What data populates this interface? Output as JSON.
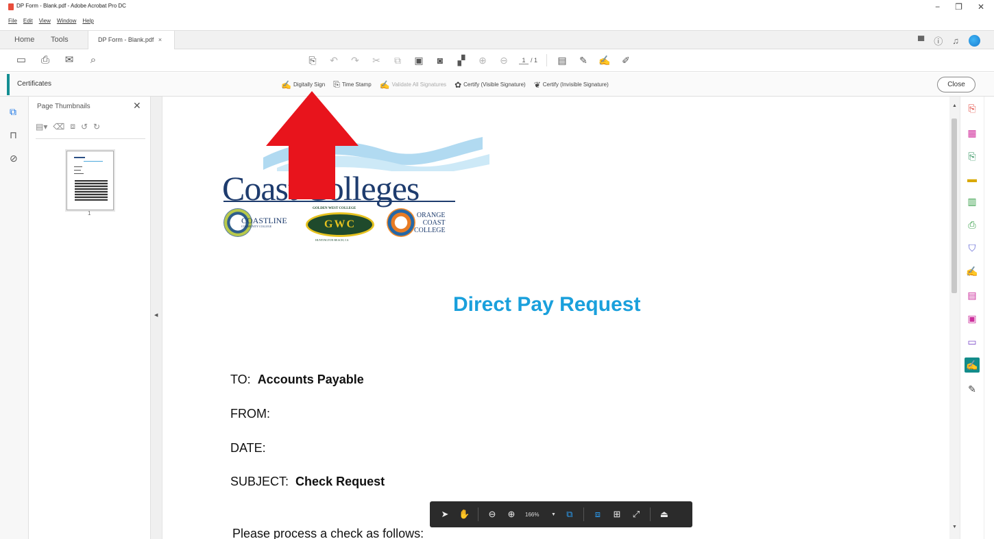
{
  "window": {
    "title": "DP Form - Blank.pdf - Adobe Acrobat Pro DC",
    "controls": [
      "−",
      "❐",
      "✕"
    ]
  },
  "menu": [
    "File",
    "Edit",
    "View",
    "Window",
    "Help"
  ],
  "tabs": {
    "home": "Home",
    "tools": "Tools",
    "doc": "DP Form - Blank.pdf",
    "doc_close": "×"
  },
  "toolbar": {
    "page_current": "1",
    "page_total": "/ 1"
  },
  "certificates": {
    "title": "Certificates",
    "tools": [
      {
        "label": "Digitally Sign",
        "icon": "pen-sign-icon",
        "enabled": true
      },
      {
        "label": "Time Stamp",
        "icon": "time-stamp-icon",
        "enabled": true
      },
      {
        "label": "Validate All Signatures",
        "icon": "validate-icon",
        "enabled": false
      },
      {
        "label": "Certify (Visible Signature)",
        "icon": "certify-visible-icon",
        "enabled": true
      },
      {
        "label": "Certify (Invisible Signature)",
        "icon": "certify-invisible-icon",
        "enabled": true
      }
    ],
    "close": "Close"
  },
  "thumbnails": {
    "title": "Page Thumbnails",
    "close": "✕",
    "page_label": "1"
  },
  "document": {
    "logo": {
      "wordmark": "Coast Colleges",
      "coastline": "COASTLINE",
      "coastline_sub": "COMMUNITY COLLEGE",
      "gwc": "GWC",
      "gwc_top": "GOLDEN WEST COLLEGE",
      "gwc_bottom": "HUNTINGTON BEACH, CA",
      "occ_1": "ORANGE",
      "occ_2": "COAST",
      "occ_3": "COLLEGE"
    },
    "heading": "Direct Pay Request",
    "to_label": "TO:",
    "to_value": "Accounts Payable",
    "from_label": "FROM:",
    "date_label": "DATE:",
    "subject_label": "SUBJECT:",
    "subject_value": "Check Request",
    "instruction": "Please process a check as follows:"
  },
  "floating_toolbar": {
    "zoom": "166%"
  },
  "colors": {
    "accent_teal": "#138c8a",
    "heading_blue": "#1aa0dc",
    "annotation_red": "#e8141c"
  }
}
